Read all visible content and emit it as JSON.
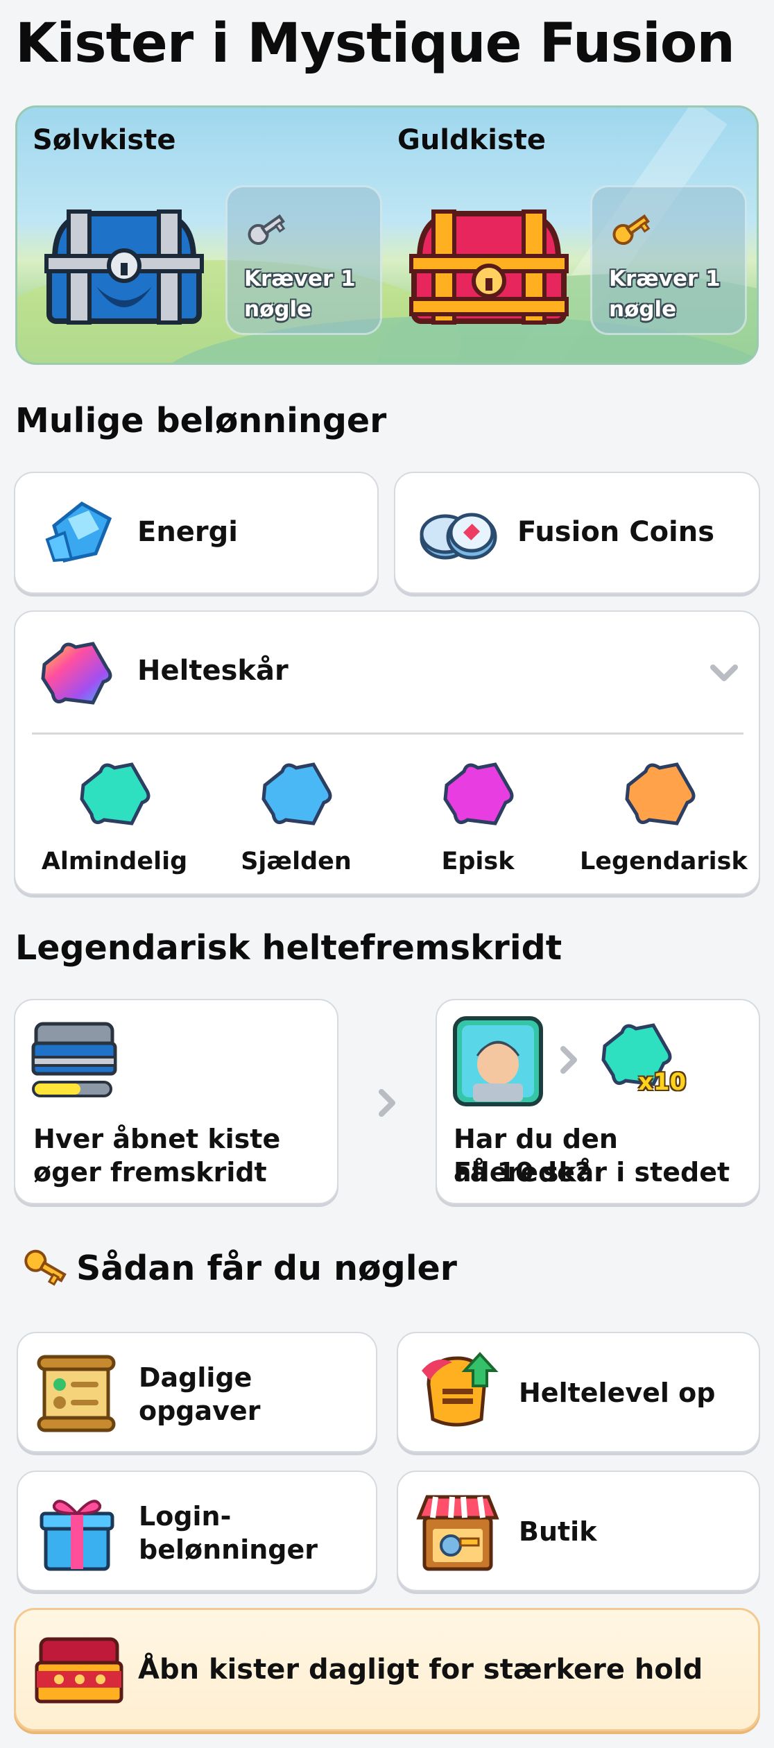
{
  "title": "Kister i Mystique Fusion",
  "hero": {
    "silver": {
      "name": "Sølvkiste",
      "requirement": "Kræver 1 nøgle"
    },
    "gold": {
      "name": "Guldkiste",
      "requirement": "Kræver 1 nøgle"
    }
  },
  "rewards": {
    "heading": "Mulige belønninger",
    "energy": "Energi",
    "coins": "Fusion Coins",
    "shards": {
      "label": "Helteskår",
      "items": [
        "Almindelig",
        "Sjælden",
        "Episk",
        "Legendarisk"
      ]
    }
  },
  "progress": {
    "heading": "Legendarisk heltefremskridt",
    "left_line1": "Hver åbnet kiste",
    "left_line2": "øger fremskridt",
    "right_line1": "Har du den allerede?",
    "right_line2": "Få 10 skår i stedet",
    "multiplier": "x10"
  },
  "keys": {
    "heading": "Sådan får du nøgler",
    "daily_line1": "Daglige",
    "daily_line2": "opgaver",
    "levelup": "Heltelevel op",
    "login_line1": "Login-",
    "login_line2": "belønninger",
    "shop": "Butik"
  },
  "banner": "Åbn kister dagligt for stærkere hold",
  "colors": {
    "common": "#2ee0c0",
    "rare": "#4ab8f5",
    "epic": "#e83de0",
    "legendary": "#ffa24a"
  }
}
